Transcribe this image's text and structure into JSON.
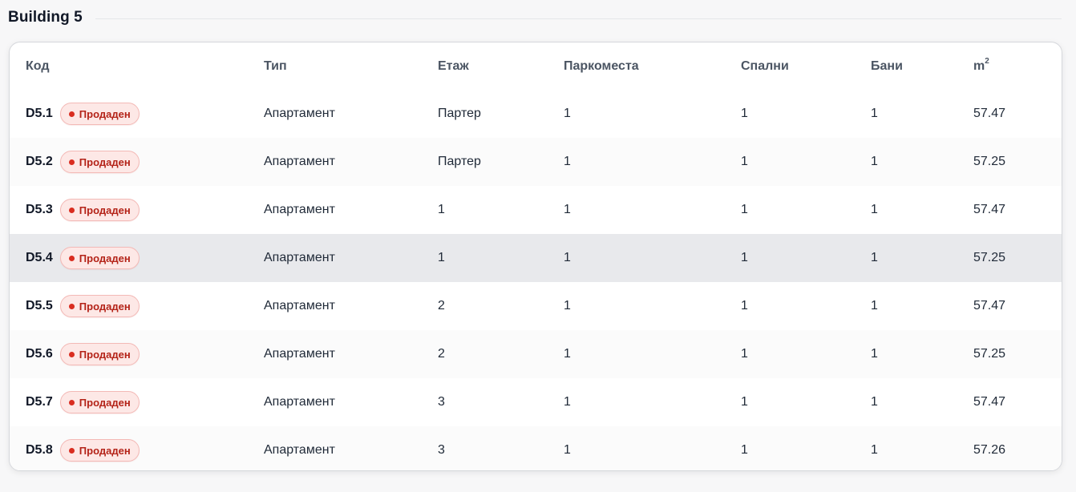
{
  "section": {
    "title": "Building 5"
  },
  "table": {
    "headers": {
      "code": "Код",
      "type": "Тип",
      "floor": "Етаж",
      "parking": "Паркоместа",
      "bedrooms": "Спални",
      "bathrooms": "Бани",
      "area_base": "m",
      "area_sup": "2"
    },
    "rows": [
      {
        "code": "D5.1",
        "status": "Продаден",
        "type": "Апартамент",
        "floor": "Партер",
        "parking": "1",
        "bedrooms": "1",
        "bathrooms": "1",
        "area": "57.47"
      },
      {
        "code": "D5.2",
        "status": "Продаден",
        "type": "Апартамент",
        "floor": "Партер",
        "parking": "1",
        "bedrooms": "1",
        "bathrooms": "1",
        "area": "57.25"
      },
      {
        "code": "D5.3",
        "status": "Продаден",
        "type": "Апартамент",
        "floor": "1",
        "parking": "1",
        "bedrooms": "1",
        "bathrooms": "1",
        "area": "57.47"
      },
      {
        "code": "D5.4",
        "status": "Продаден",
        "type": "Апартамент",
        "floor": "1",
        "parking": "1",
        "bedrooms": "1",
        "bathrooms": "1",
        "area": "57.25"
      },
      {
        "code": "D5.5",
        "status": "Продаден",
        "type": "Апартамент",
        "floor": "2",
        "parking": "1",
        "bedrooms": "1",
        "bathrooms": "1",
        "area": "57.47"
      },
      {
        "code": "D5.6",
        "status": "Продаден",
        "type": "Апартамент",
        "floor": "2",
        "parking": "1",
        "bedrooms": "1",
        "bathrooms": "1",
        "area": "57.25"
      },
      {
        "code": "D5.7",
        "status": "Продаден",
        "type": "Апартамент",
        "floor": "3",
        "parking": "1",
        "bedrooms": "1",
        "bathrooms": "1",
        "area": "57.47"
      },
      {
        "code": "D5.8",
        "status": "Продаден",
        "type": "Апартамент",
        "floor": "3",
        "parking": "1",
        "bedrooms": "1",
        "bathrooms": "1",
        "area": "57.26"
      }
    ]
  },
  "colors": {
    "sold_badge_bg": "#fde8e6",
    "sold_badge_text": "#b42318",
    "sold_dot": "#d92d20",
    "hover_row": "#e8e9ec"
  }
}
